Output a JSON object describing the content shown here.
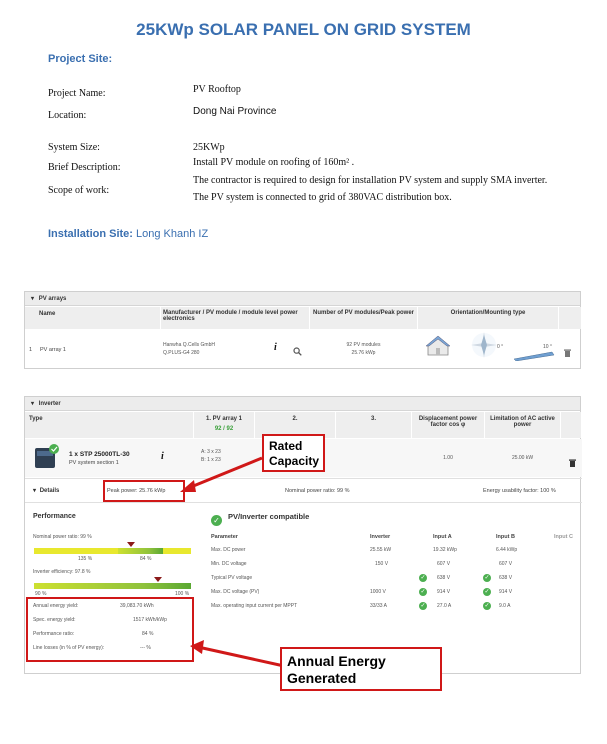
{
  "title": "25KWp SOLAR PANEL ON GRID SYSTEM",
  "project_site_heading": "Project Site:",
  "fields": {
    "project_name_label": "Project Name:",
    "project_name": "PV Rooftop",
    "location_label": "Location:",
    "location": "Dong Nai Province",
    "system_size_label": "System Size:",
    "system_size": "25KWp",
    "brief_label": "Brief Description:",
    "brief": "Install PV module on roofing of 160m² .",
    "scope_label": "Scope of work:",
    "scope_line1": "The contractor is required to design for installation PV system and supply SMA inverter.",
    "scope_line2": "The PV system is connected to grid of 380VAC distribution box."
  },
  "installation_label": "Installation Site:",
  "installation_value": "Long Khanh IZ",
  "pv_arrays": {
    "header": "PV arrays",
    "col_name": "Name",
    "col_manufacturer": "Manufacturer / PV module / module level power electronics",
    "col_modules": "Number of PV modules/Peak power",
    "col_orientation": "Orientation/Mounting type",
    "row_index": "1",
    "row_name": "PV array 1",
    "row_manuf1": "Hanwha Q.Cells GmbH",
    "row_manuf2": "Q.PLUS-G4 280",
    "row_modules1": "92 PV modules",
    "row_modules2": "25.76 kWp",
    "angle1": "0 °",
    "angle2": "10 °"
  },
  "inverter": {
    "header": "Inverter",
    "col_type": "Type",
    "col_arr1": "1. PV array 1",
    "col_arr1_count": "92 / 92",
    "col_2": "2.",
    "col_3": "3.",
    "col_disp": "Displacement power factor cos φ",
    "col_limit": "Limitation of AC active power",
    "name": "1 x STP 25000TL-30",
    "subname": "PV system section 1",
    "a_val": "A: 3 x 23",
    "b_val": "B: 1 x 23",
    "cos_val": "1.00",
    "limit_val": "25.00 kW"
  },
  "details": {
    "tab": "Details",
    "peak_power": "Peak power: 25.76 kWp",
    "nominal_ratio": "Nominal power ratio: 99 %",
    "energy_usability": "Energy usability factor: 100 %"
  },
  "performance": {
    "heading": "Performance",
    "npr_label": "Nominal power ratio: 99 %",
    "npr_left": "135 %",
    "npr_right": "84 %",
    "eff_label": "Inverter efficiency: 97.8 %",
    "eff_left": "90 %",
    "eff_right": "100 %",
    "rows": [
      {
        "label": "Annual energy yield:",
        "value": "39,083.70 kWh"
      },
      {
        "label": "Spec. energy yield:",
        "value": "1517 kWh/kWp"
      },
      {
        "label": "Performance ratio:",
        "value": "84 %"
      },
      {
        "label": "Line losses (in % of PV energy):",
        "value": "--- %"
      }
    ]
  },
  "compat": {
    "heading": "PV/Inverter compatible",
    "headers": [
      "Parameter",
      "Inverter",
      "Input A",
      "Input B",
      "Input C"
    ],
    "rows": [
      {
        "param": "Max. DC power",
        "inv": "25.55 kW",
        "a": "19.32 kWp",
        "b": "6.44 kWp",
        "a_check": false,
        "b_check": false
      },
      {
        "param": "Min. DC voltage",
        "inv": "150 V",
        "a": "607 V",
        "b": "607 V",
        "a_check": false,
        "b_check": false
      },
      {
        "param": "Typical PV voltage",
        "inv": "",
        "a": "638 V",
        "b": "638 V",
        "a_check": true,
        "b_check": true
      },
      {
        "param": "Max. DC voltage (PV)",
        "inv": "1000 V",
        "a": "914 V",
        "b": "914 V",
        "a_check": true,
        "b_check": true
      },
      {
        "param": "Max. operating input current per MPPT",
        "inv": "33/33 A",
        "a": "27.0 A",
        "b": "9.0 A",
        "a_check": true,
        "b_check": true
      }
    ]
  },
  "callouts": {
    "rated1": "Rated",
    "rated2": "Capacity",
    "annual1": "Annual Energy",
    "annual2": "Generated"
  },
  "colors": {
    "heading_blue": "#3a6fb0",
    "callout_red": "#d01818",
    "check_green": "#4caf50"
  }
}
